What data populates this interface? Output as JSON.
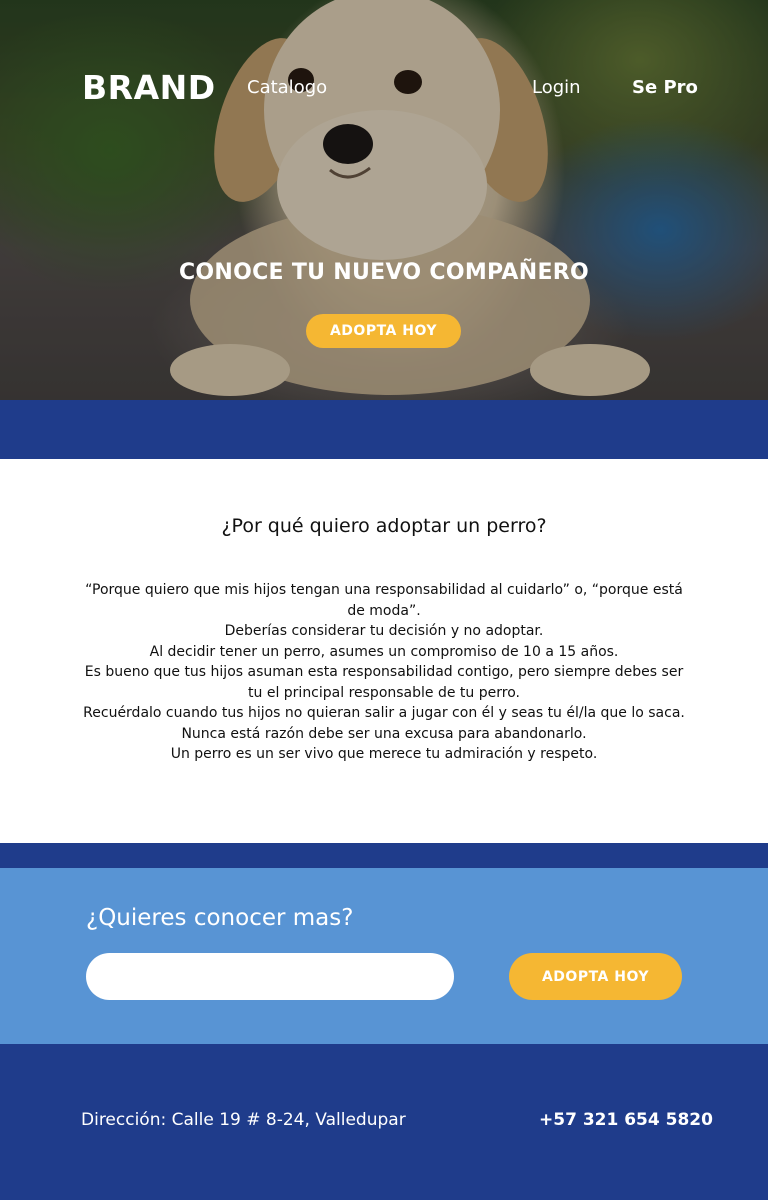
{
  "header": {
    "brand": "BRAND",
    "nav": {
      "catalogo": "Catalogo",
      "login": "Login",
      "se_pro": "Se Pro"
    }
  },
  "hero": {
    "title": "CONOCE TU NUEVO COMPAÑERO",
    "button_label": "ADOPTA HOY",
    "image": "golden-retriever-puppy-photo"
  },
  "why": {
    "title": "¿Por qué quiero adoptar un perro?",
    "paragraphs": [
      "“Porque quiero que mis hijos tengan una responsabilidad al cuidarlo” o, “porque está de moda”.",
      "Deberías considerar tu decisión y no adoptar.",
      "Al decidir tener un perro, asumes un compromiso de 10 a 15 años.",
      "Es bueno que tus hijos asuman esta responsabilidad contigo, pero siempre debes ser tu el principal responsable de tu perro.",
      "Recuérdalo cuando tus hijos no quieran salir a jugar con él y seas tu él/la que lo saca.",
      "Nunca está razón debe ser una excusa para abandonarlo.",
      "Un perro es un ser vivo que merece tu admiración y respeto."
    ]
  },
  "cta": {
    "title": "¿Quieres conocer mas?",
    "input_value": "",
    "button_label": "ADOPTA HOY"
  },
  "footer": {
    "address": "Dirección: Calle 19 # 8-24, Valledupar",
    "phone": "+57 321 654 5820"
  },
  "colors": {
    "navy": "#1f3c8b",
    "light_blue": "#5894d4",
    "accent_yellow": "#f5b733",
    "white": "#ffffff"
  }
}
